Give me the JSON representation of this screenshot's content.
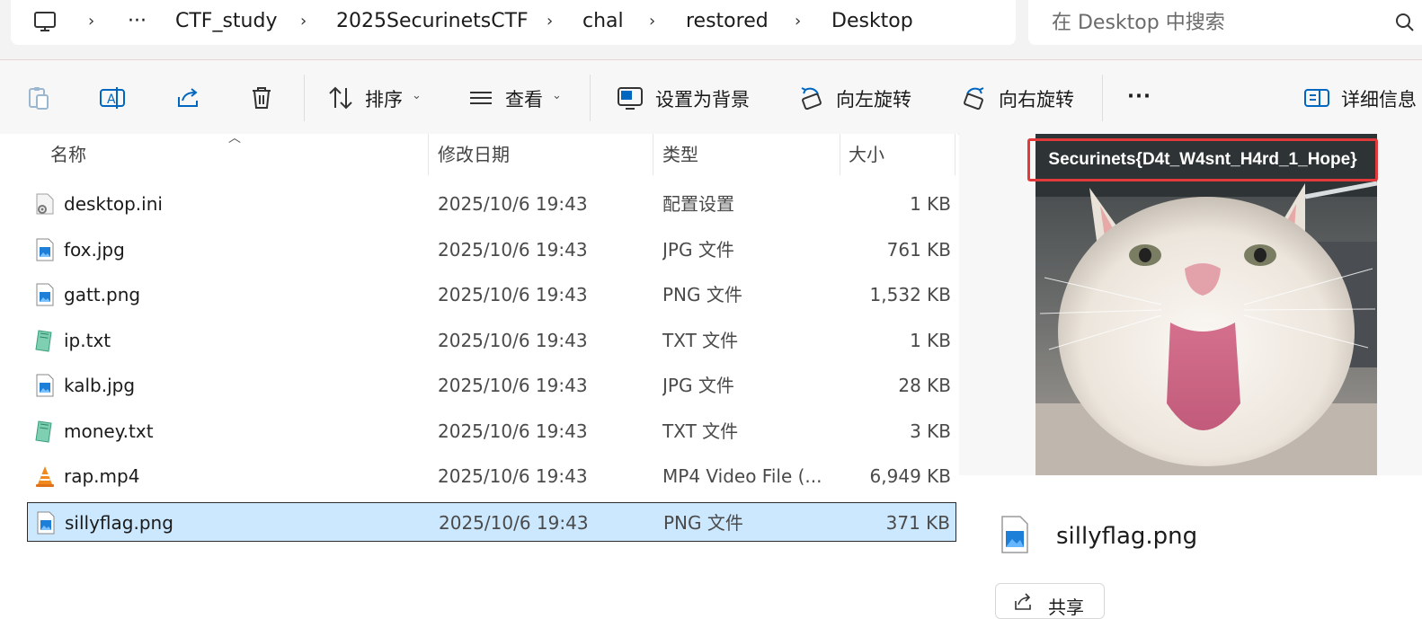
{
  "address": {
    "breadcrumb": [
      "···",
      "CTF_study",
      "2025SecurinetsCTF",
      "chal",
      "restored",
      "Desktop"
    ],
    "separator": "›",
    "search_placeholder": "在 Desktop 中搜索"
  },
  "toolbar": {
    "sort_label": "排序",
    "view_label": "查看",
    "set_background_label": "设置为背景",
    "rotate_left_label": "向左旋转",
    "rotate_right_label": "向右旋转",
    "more_label": "···",
    "details_label": "详细信息"
  },
  "columns": {
    "name": "名称",
    "date": "修改日期",
    "type": "类型",
    "size": "大小"
  },
  "files": [
    {
      "name": "desktop.ini",
      "date": "2025/10/6 19:43",
      "type": "配置设置",
      "size": "1 KB",
      "icon": "settings-file-icon"
    },
    {
      "name": "fox.jpg",
      "date": "2025/10/6 19:43",
      "type": "JPG 文件",
      "size": "761 KB",
      "icon": "image-file-icon"
    },
    {
      "name": "gatt.png",
      "date": "2025/10/6 19:43",
      "type": "PNG 文件",
      "size": "1,532 KB",
      "icon": "image-file-icon"
    },
    {
      "name": "ip.txt",
      "date": "2025/10/6 19:43",
      "type": "TXT 文件",
      "size": "1 KB",
      "icon": "text-file-icon"
    },
    {
      "name": "kalb.jpg",
      "date": "2025/10/6 19:43",
      "type": "JPG 文件",
      "size": "28 KB",
      "icon": "image-file-icon"
    },
    {
      "name": "money.txt",
      "date": "2025/10/6 19:43",
      "type": "TXT 文件",
      "size": "3 KB",
      "icon": "text-file-icon"
    },
    {
      "name": "rap.mp4",
      "date": "2025/10/6 19:43",
      "type": "MP4 Video File (...",
      "size": "6,949 KB",
      "icon": "vlc-cone-icon"
    },
    {
      "name": "sillyflag.png",
      "date": "2025/10/6 19:43",
      "type": "PNG 文件",
      "size": "371 KB",
      "icon": "image-file-icon"
    }
  ],
  "selected_index": 7,
  "preview": {
    "overlay_text": "Securinets{D4t_W4snt_H4rd_1_Hope}",
    "file_name": "sillyflag.png",
    "share_label": "共享"
  },
  "colors": {
    "selection": "#cce8ff",
    "accent": "#0067c0",
    "highlight_box": "#e23a3a"
  }
}
